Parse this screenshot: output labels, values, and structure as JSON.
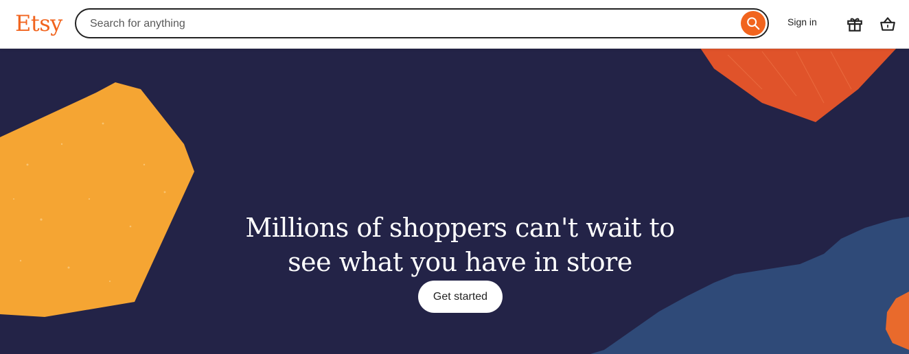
{
  "header": {
    "logo_text": "Etsy",
    "search": {
      "placeholder": "Search for anything",
      "value": ""
    },
    "sign_in_label": "Sign in",
    "icons": [
      "search-icon",
      "gift-icon",
      "shopping-bag-icon"
    ]
  },
  "hero": {
    "headline_line1": "Millions of shoppers can't wait to",
    "headline_line2": "see what you have in store",
    "cta_label": "Get started"
  },
  "colors": {
    "brand_orange": "#f1641e",
    "hero_navy": "#232347",
    "yellow_shape": "#f5a533",
    "orange_shape": "#e0532a",
    "blue_shape": "#2f4a78",
    "text_dark": "#222222"
  }
}
